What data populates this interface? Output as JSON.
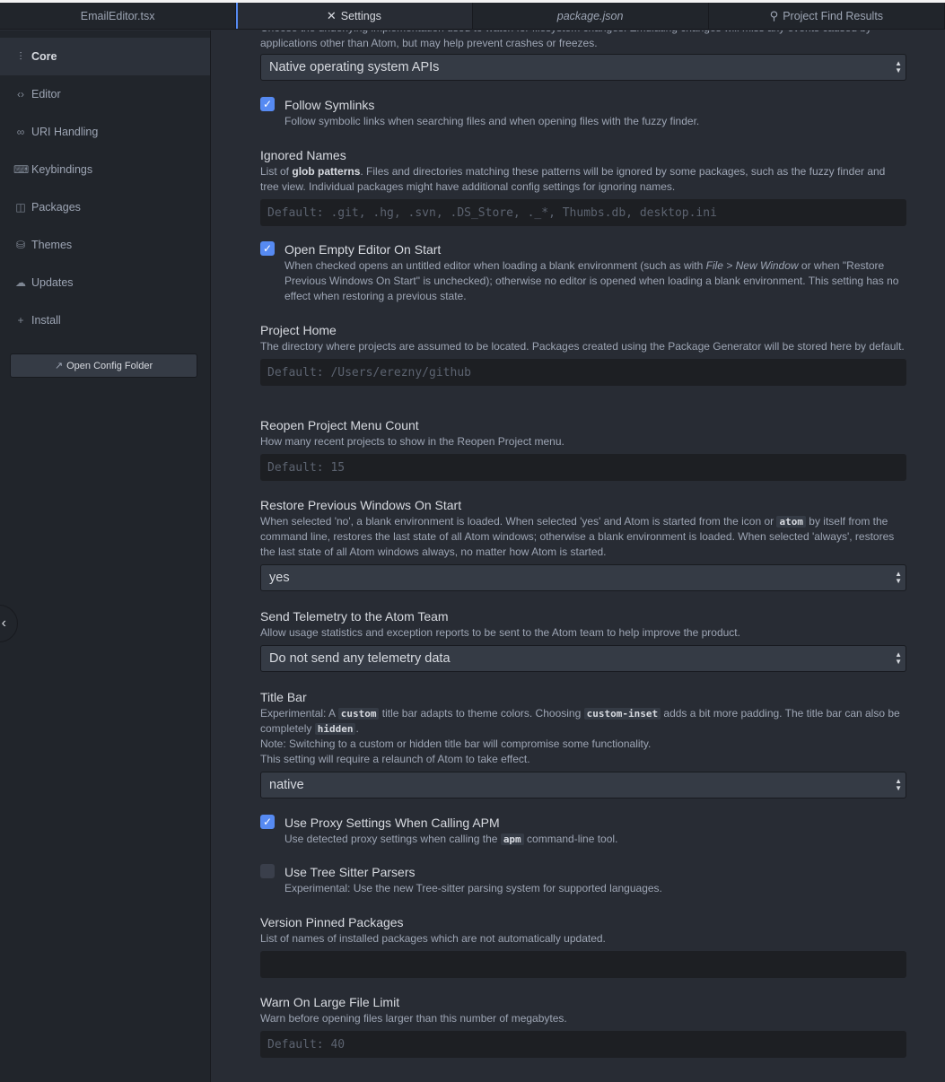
{
  "tabs": [
    {
      "label": "EmailEditor.tsx"
    },
    {
      "label": "Settings"
    },
    {
      "label": "package.json"
    },
    {
      "label": "Project Find Results"
    }
  ],
  "sidebar": {
    "items": [
      {
        "label": "Core",
        "icon": "sliders-icon"
      },
      {
        "label": "Editor",
        "icon": "code-icon"
      },
      {
        "label": "URI Handling",
        "icon": "link-icon"
      },
      {
        "label": "Keybindings",
        "icon": "keyboard-icon"
      },
      {
        "label": "Packages",
        "icon": "package-icon"
      },
      {
        "label": "Themes",
        "icon": "paintcan-icon"
      },
      {
        "label": "Updates",
        "icon": "cloud-download-icon"
      },
      {
        "label": "Install",
        "icon": "plus-icon"
      }
    ],
    "open_config_label": "Open Config Folder"
  },
  "settings": {
    "top_desc": "Choose the underlying implementation used to watch for filesystem changes. Emulating changes will miss any events caused by applications other than Atom, but may help prevent crashes or freezes.",
    "fs_watcher_value": "Native operating system APIs",
    "follow_symlinks": {
      "title": "Follow Symlinks",
      "desc": "Follow symbolic links when searching files and when opening files with the fuzzy finder.",
      "checked": true
    },
    "ignored_names": {
      "title": "Ignored Names",
      "desc_pre": "List of ",
      "desc_link": "glob patterns",
      "desc_post": ". Files and directories matching these patterns will be ignored by some packages, such as the fuzzy finder and tree view. Individual packages might have additional config settings for ignoring names.",
      "placeholder": "Default: .git, .hg, .svn, .DS_Store, ._*, Thumbs.db, desktop.ini"
    },
    "open_empty_editor": {
      "title": "Open Empty Editor On Start",
      "desc_pre": "When checked opens an untitled editor when loading a blank environment (such as with ",
      "desc_em": "File > New Window",
      "desc_post": " or when \"Restore Previous Windows On Start\" is unchecked); otherwise no editor is opened when loading a blank environment. This setting has no effect when restoring a previous state.",
      "checked": true
    },
    "project_home": {
      "title": "Project Home",
      "desc": "The directory where projects are assumed to be located. Packages created using the Package Generator will be stored here by default.",
      "placeholder": "Default: /Users/erezny/github"
    },
    "reopen_count": {
      "title": "Reopen Project Menu Count",
      "desc": "How many recent projects to show in the Reopen Project menu.",
      "placeholder": "Default: 15"
    },
    "restore_windows": {
      "title": "Restore Previous Windows On Start",
      "desc_pre": "When selected 'no', a blank environment is loaded. When selected 'yes' and Atom is started from the icon or ",
      "desc_code": "atom",
      "desc_post": " by itself from the command line, restores the last state of all Atom windows; otherwise a blank environment is loaded. When selected 'always', restores the last state of all Atom windows always, no matter how Atom is started.",
      "value": "yes"
    },
    "telemetry": {
      "title": "Send Telemetry to the Atom Team",
      "desc": "Allow usage statistics and exception reports to be sent to the Atom team to help improve the product.",
      "value": "Do not send any telemetry data"
    },
    "title_bar": {
      "title": "Title Bar",
      "desc_1": "Experimental: A ",
      "code_1": "custom",
      "desc_2": " title bar adapts to theme colors. Choosing ",
      "code_2": "custom-inset",
      "desc_3": " adds a bit more padding. The title bar can also be completely ",
      "code_3": "hidden",
      "desc_4": ".",
      "note": "Note: Switching to a custom or hidden title bar will compromise some functionality.",
      "relaunch": "This setting will require a relaunch of Atom to take effect.",
      "value": "native"
    },
    "proxy": {
      "title": "Use Proxy Settings When Calling APM",
      "desc_pre": "Use detected proxy settings when calling the ",
      "desc_code": "apm",
      "desc_post": " command-line tool.",
      "checked": true
    },
    "tree_sitter": {
      "title": "Use Tree Sitter Parsers",
      "desc": "Experimental: Use the new Tree-sitter parsing system for supported languages.",
      "checked": false
    },
    "version_pinned": {
      "title": "Version Pinned Packages",
      "desc": "List of names of installed packages which are not automatically updated.",
      "placeholder": ""
    },
    "large_file": {
      "title": "Warn On Large File Limit",
      "desc": "Warn before opening files larger than this number of megabytes.",
      "placeholder": "Default: 40"
    }
  },
  "colors": {
    "accent": "#568af2",
    "background": "#282c34",
    "sidebar": "#21252b"
  }
}
